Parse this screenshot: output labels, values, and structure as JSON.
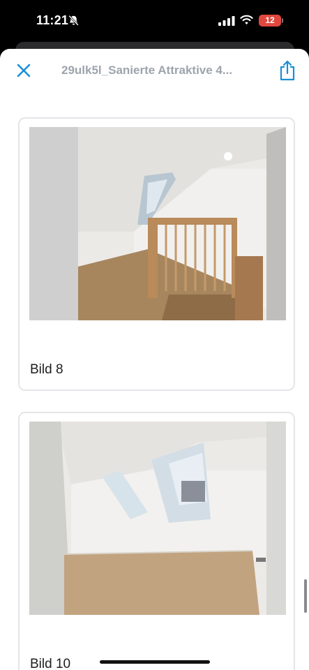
{
  "status_bar": {
    "time": "11:21",
    "battery_level": "12",
    "icons": [
      "bell-slash-icon",
      "cellular-signal-icon",
      "wifi-icon",
      "battery-icon"
    ]
  },
  "header": {
    "title": "29ulk5l_Sanierte Attraktive 4...",
    "close_icon": "close-icon",
    "share_icon": "share-icon"
  },
  "gallery": {
    "items": [
      {
        "caption": "Bild 8",
        "image": "attic staircase with wooden railing and skylight"
      },
      {
        "caption": "Bild 10",
        "image": "empty attic room with two skylights and wooden floor"
      }
    ]
  },
  "colors": {
    "accent": "#1a8fd6",
    "title_gray": "#9da4ad",
    "battery_red": "#e1473e",
    "card_border": "#e3e5e8"
  }
}
